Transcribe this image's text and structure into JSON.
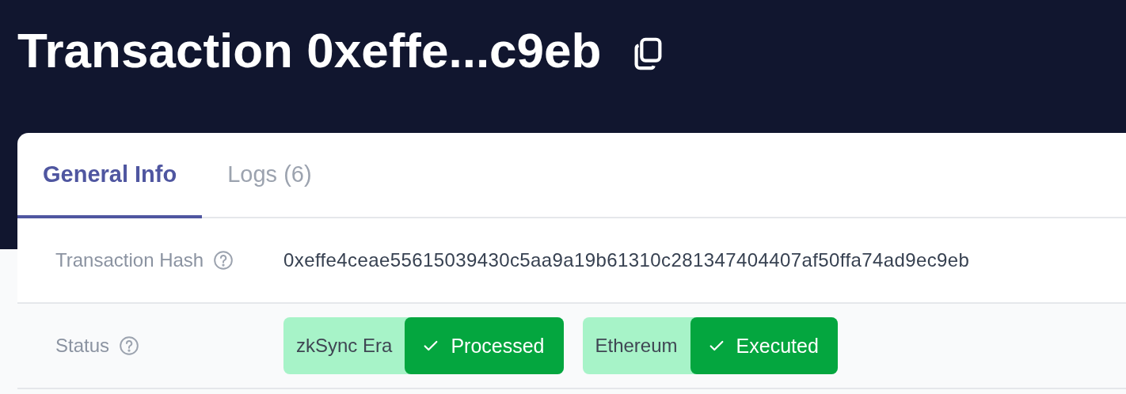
{
  "header": {
    "title": "Transaction 0xeffe...c9eb"
  },
  "tabs": [
    {
      "label": "General Info",
      "selected": true
    },
    {
      "label": "Logs (6)",
      "selected": false
    }
  ],
  "rows": [
    {
      "label": "Transaction Hash",
      "kind": "text",
      "value": "0xeffe4ceae55615039430c5aa9a19b61310c281347404407af50ffa74ad9ec9eb"
    },
    {
      "label": "Status",
      "kind": "status",
      "badges": [
        {
          "network": "zkSync Era",
          "status": "Processed",
          "done": true
        },
        {
          "network": "Ethereum",
          "status": "Executed",
          "done": true
        }
      ]
    }
  ]
}
